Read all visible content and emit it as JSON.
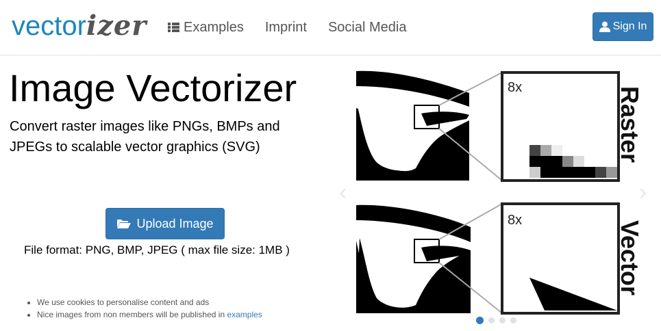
{
  "logo": {
    "part1": "vector",
    "part2": "izer"
  },
  "nav": {
    "examples": "Examples",
    "imprint": "Imprint",
    "social": "Social Media",
    "signin": "Sign In"
  },
  "main": {
    "title": "Image Vectorizer",
    "subtitle": "Convert raster images like PNGs, BMPs and JPEGs to scalable vector graphics (SVG)",
    "upload_label": "Upload Image",
    "format_text": "File format: PNG, BMP, JPEG ( max file size: 1MB )"
  },
  "notes": {
    "cookies": "We use cookies to personalise content and ads",
    "published_prefix": "Nice images from non members will be published in ",
    "published_link": "examples"
  },
  "carousel": {
    "raster_label": "Raster",
    "vector_label": "Vector",
    "zoom_top": "8x",
    "zoom_bottom": "8x",
    "slides": 4,
    "active_slide": 1
  },
  "colors": {
    "accent": "#337ab7",
    "logo_blue": "#1b86bd",
    "nav_text": "#555555"
  },
  "icons": [
    "list-icon",
    "user-icon",
    "folder-open-icon",
    "chevron-left-icon",
    "chevron-right-icon"
  ]
}
